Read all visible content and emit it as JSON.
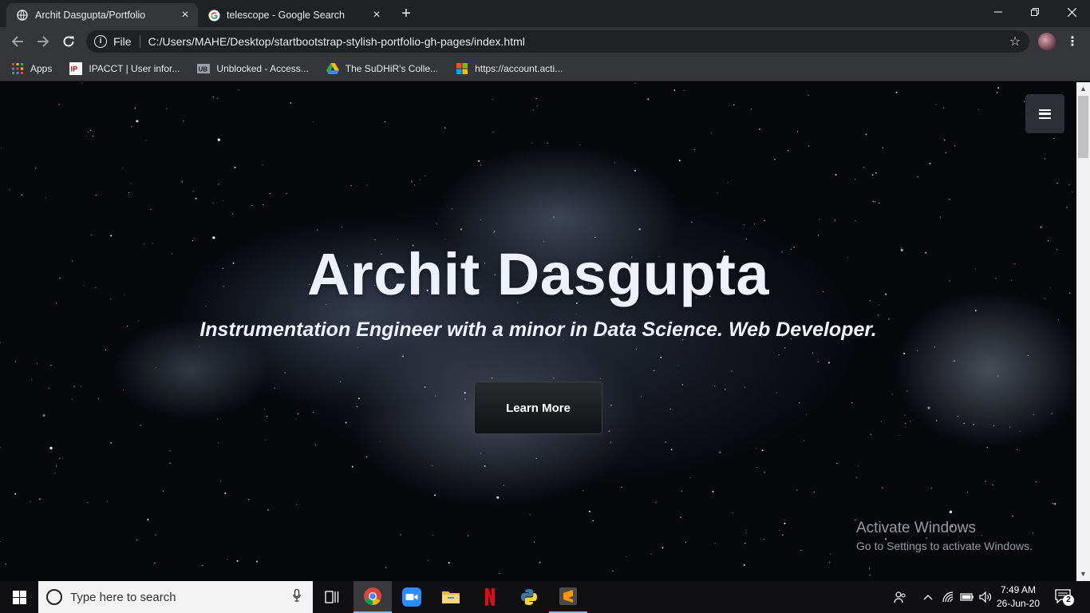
{
  "browser": {
    "tabs": [
      {
        "title": "Archit Dasgupta/Portfolio",
        "active": true
      },
      {
        "title": "telescope - Google Search",
        "active": false
      }
    ],
    "address": {
      "scheme_label": "File",
      "url": "C:/Users/MAHE/Desktop/startbootstrap-stylish-portfolio-gh-pages/index.html"
    },
    "bookmarks": [
      {
        "label": "Apps",
        "icon": "apps-grid-icon"
      },
      {
        "label": "IPACCT | User infor...",
        "icon": "ipacct-icon"
      },
      {
        "label": "Unblocked - Access...",
        "icon": "ub-icon"
      },
      {
        "label": "The SuDHiR's Colle...",
        "icon": "google-drive-icon"
      },
      {
        "label": "https://account.acti...",
        "icon": "microsoft-icon"
      }
    ]
  },
  "page": {
    "name": "Archit Dasgupta",
    "tagline": "Instrumentation Engineer with a minor in Data Science. Web Developer.",
    "cta_label": "Learn More"
  },
  "watermark": {
    "line1": "Activate Windows",
    "line2": "Go to Settings to activate Windows."
  },
  "taskbar": {
    "search_placeholder": "Type here to search",
    "apps": [
      "task-view",
      "chrome",
      "zoom",
      "file-explorer",
      "netflix",
      "python",
      "sublime-text"
    ],
    "time": "7:49 AM",
    "date": "26-Jun-20",
    "notifications": "2"
  },
  "colors": {
    "chrome_dark": "#202124",
    "chrome_tab": "#35363a",
    "hero_text": "#eef0fb",
    "taskbar": "#101012"
  }
}
